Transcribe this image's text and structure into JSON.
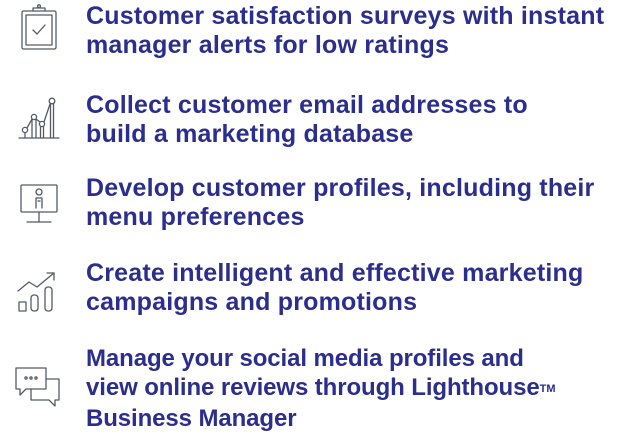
{
  "features": [
    {
      "icon": "clipboard-check-icon",
      "lines": [
        "Customer satisfaction surveys with instant",
        "manager alerts for low ratings"
      ]
    },
    {
      "icon": "network-nodes-icon",
      "lines": [
        "Collect customer email addresses to",
        "build a marketing database"
      ]
    },
    {
      "icon": "monitor-profile-icon",
      "lines": [
        "Develop customer profiles, including their",
        "menu preferences"
      ]
    },
    {
      "icon": "growth-chart-icon",
      "lines": [
        "Create intelligent and effective marketing",
        "campaigns and promotions"
      ]
    },
    {
      "icon": "chat-bubbles-icon",
      "lines": [
        "Manage your social media profiles and",
        "view online reviews through Lighthouse",
        "Business Manager"
      ],
      "trademark": "TM"
    }
  ],
  "colors": {
    "text": "#2b2e8d",
    "icon_stroke": "#555a66"
  }
}
